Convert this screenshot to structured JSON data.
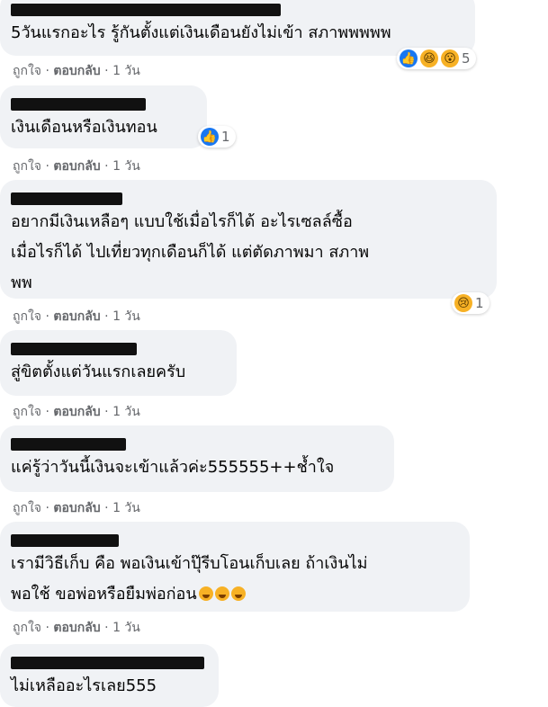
{
  "comments": [
    {
      "text": "5วันแรกอะไร รู้กันตั้งแต่เงินเดือนยังไม่เข้า สภาพพพพพ",
      "like": "ถูกใจ",
      "reply": "ตอบกลับ",
      "time": "1 วัน",
      "react_count": "5"
    },
    {
      "text": "เงินเดือนหรือเงินทอน",
      "like": "ถูกใจ",
      "reply": "ตอบกลับ",
      "time": "1 วัน",
      "react_count": "1"
    },
    {
      "text": "อยากมีเงินเหลือๆ แบบใช้เมื่อไรก็ได้ อะไรเซลล์ซื้อ\nเมื่อไรก็ได้ ไปเที่ยวทุกเดือนก็ได้ แต่ตัดภาพมา สภาพ\nพพ",
      "like": "ถูกใจ",
      "reply": "ตอบกลับ",
      "time": "1 วัน",
      "react_count": "1"
    },
    {
      "text": "สู่ขิตตั้งแต่วันแรกเลยครับ",
      "like": "ถูกใจ",
      "reply": "ตอบกลับ",
      "time": "1 วัน"
    },
    {
      "text": "แค่รู้ว่าวันนี้เงินจะเข้าแล้วค่ะ555555++ช้ำใจ",
      "like": "ถูกใจ",
      "reply": "ตอบกลับ",
      "time": "1 วัน"
    },
    {
      "text": "เรามีวิธีเก็บ คือ พอเงินเข้าปุ๊รีบโอนเก็บเลย ถ้าเงินไม่\nพอใช้ ขอพ่อหรือยืมพ่อก่อน",
      "like": "ถูกใจ",
      "reply": "ตอบกลับ",
      "time": "1 วัน"
    },
    {
      "text": "ไม่เหลืออะไรเลย555"
    }
  ],
  "separator": " · "
}
